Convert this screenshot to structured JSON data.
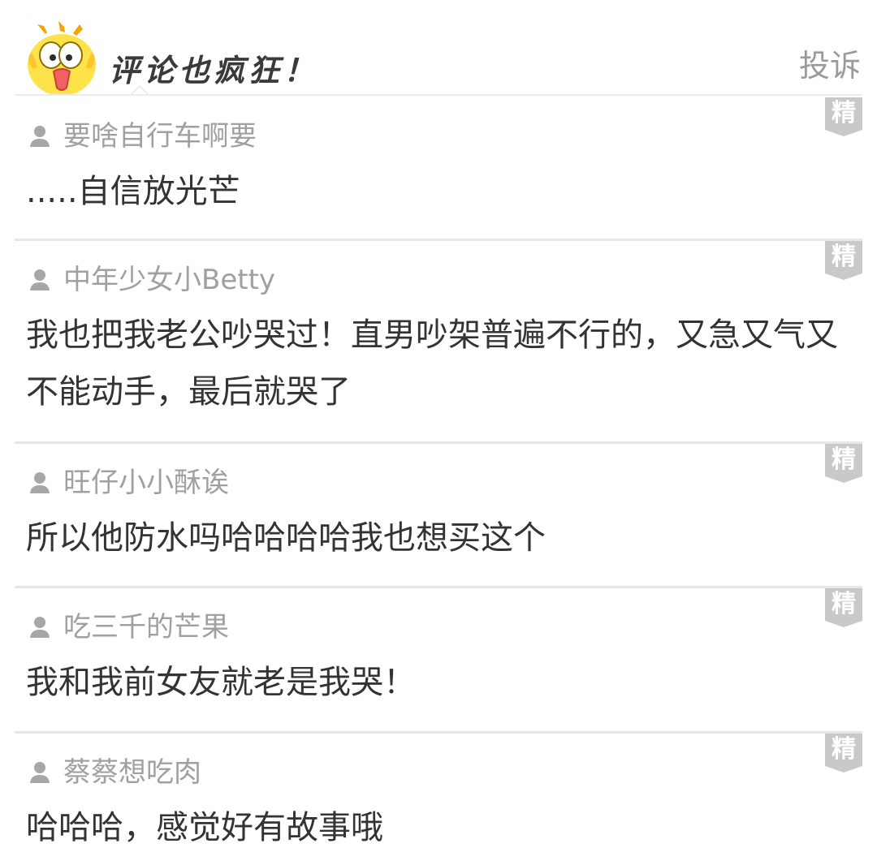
{
  "header": {
    "title": "评论也疯狂！",
    "complaint_label": "投诉",
    "mascot_icon": "yellow-chick-mascot-icon"
  },
  "colors": {
    "badge_bg": "#c9c9c9",
    "divider": "#e7e7e7",
    "username": "#a0a0a0",
    "comment_text": "#333333",
    "complaint_text": "#9a9a9a"
  },
  "comments": [
    {
      "username": "要啥自行车啊要",
      "text": ".....自信放光芒",
      "badge": "精"
    },
    {
      "username": "中年少女小Betty",
      "text": "我也把我老公吵哭过！直男吵架普遍不行的，又急又气又不能动手，最后就哭了",
      "badge": "精"
    },
    {
      "username": "旺仔小小酥诶",
      "text": "所以他防水吗哈哈哈哈我也想买这个",
      "badge": "精"
    },
    {
      "username": "吃三千的芒果",
      "text": "我和我前女友就老是我哭！",
      "badge": "精"
    },
    {
      "username": "蔡蔡想吃肉",
      "text": "哈哈哈，感觉好有故事哦",
      "badge": "精"
    }
  ]
}
